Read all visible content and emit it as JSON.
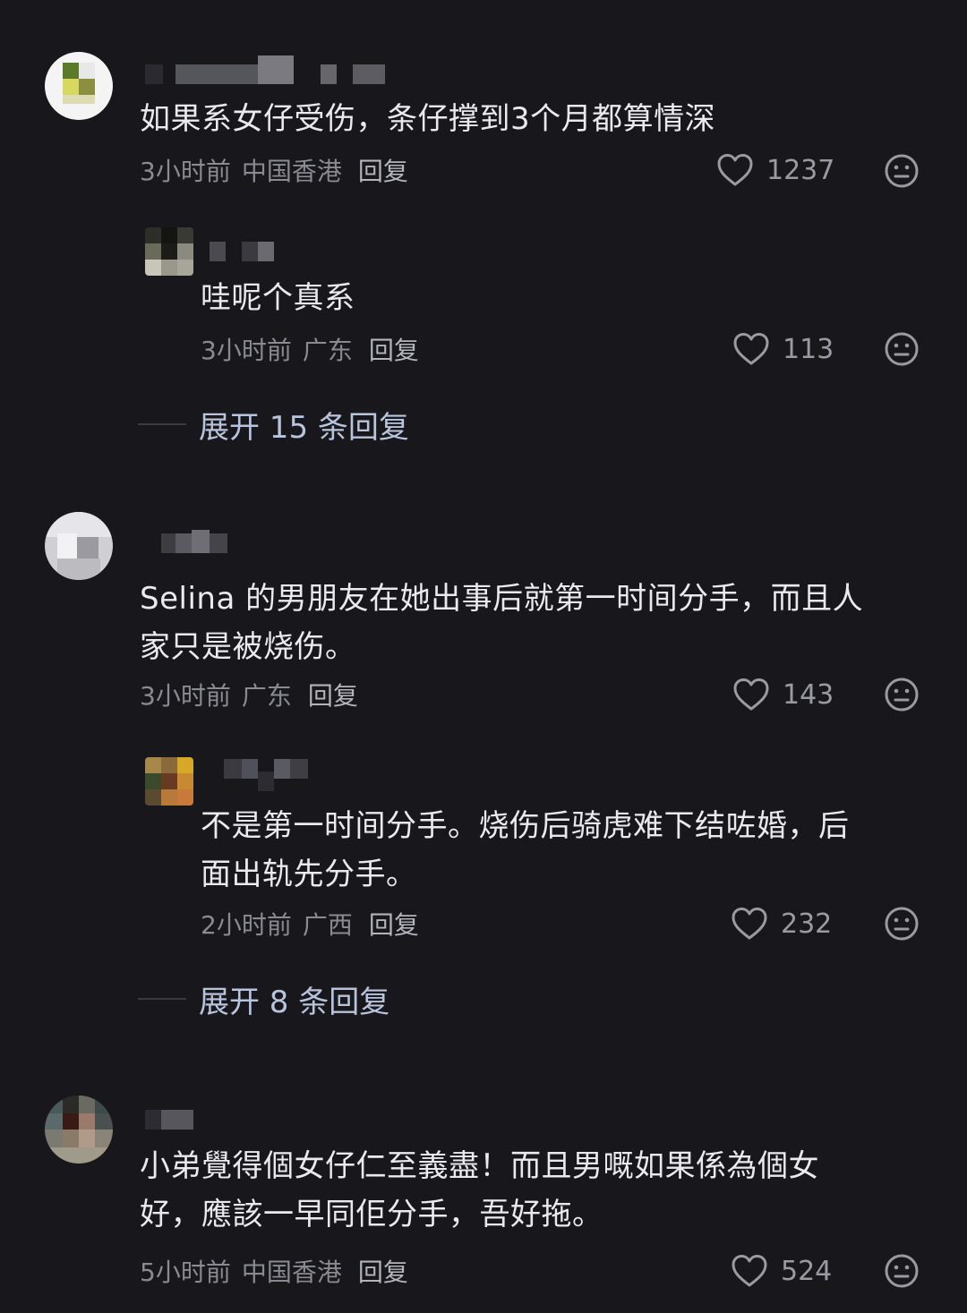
{
  "comments": [
    {
      "text": "如果系女仔受伤，条仔撑到3个月都算情深",
      "time": "3小时前",
      "location": "中国香港",
      "reply_label": "回复",
      "likes": "1237",
      "replies": [
        {
          "text": "哇呢个真系",
          "time": "3小时前",
          "location": "广东",
          "reply_label": "回复",
          "likes": "113"
        }
      ],
      "expand_label": "展开 15 条回复"
    },
    {
      "text": "Selina 的男朋友在她出事后就第一时间分手，而且人\n家只是被烧伤。",
      "time": "3小时前",
      "location": "广东",
      "reply_label": "回复",
      "likes": "143",
      "replies": [
        {
          "text": "不是第一时间分手。烧伤后骑虎难下结咗婚，后\n面出轨先分手。",
          "time": "2小时前",
          "location": "广西",
          "reply_label": "回复",
          "likes": "232"
        }
      ],
      "expand_label": "展开 8 条回复"
    },
    {
      "text": "小弟覺得個女仔仁至義盡！而且男嘅如果係為個女\n好，應該一早同佢分手，吾好拖。",
      "time": "5小时前",
      "location": "中国香港",
      "reply_label": "回复",
      "likes": "524"
    }
  ],
  "icons": {
    "like": "heart-outline-icon",
    "emoji": "neutral-face-icon"
  },
  "colors": {
    "background": "#17171c",
    "text": "#e9e9ee",
    "meta": "#8a8a92",
    "expand": "#b8c4dc"
  }
}
